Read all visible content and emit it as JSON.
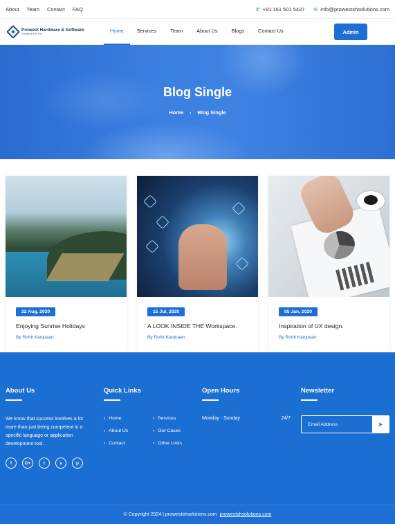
{
  "topbar": {
    "links": [
      "About",
      "Team",
      "Contact",
      "FAQ"
    ],
    "phone_icon": "phone-icon",
    "phone": "+91 161 501 5437",
    "email_icon": "mail-icon",
    "email": "info@prowestshsolutions.com"
  },
  "nav": {
    "logo_name": "Prowest Hardware & Software",
    "logo_sub": "Solutions Pvt. Ltd.",
    "items": [
      "Home",
      "Services",
      "Team",
      "About Us",
      "Blogs",
      "Contact Us"
    ],
    "active": "Home",
    "admin_label": "Admin",
    "accent": "#1d6fd6"
  },
  "hero": {
    "title": "Blog Single",
    "crumb_home": "Home",
    "crumb_sep": "›",
    "crumb_current": "Blog Single"
  },
  "posts": [
    {
      "date": "22 Aug, 2020",
      "title": "Enjoying Sunrise Holidays",
      "author": "By Rohit Kanjuaan"
    },
    {
      "date": "15 Jul, 2020",
      "title": "A LOOK INSIDE THE Workspace.",
      "author": "By Rohit Kanjuaan"
    },
    {
      "date": "05 Jan, 2020",
      "title": "Inspiration of UX design.",
      "author": "By Rohit Kanjuaan"
    }
  ],
  "footer": {
    "about_title": "About Us",
    "about_text": "We know that success involves a lot more than just being competent in a specific language or application development tool.",
    "socials": [
      "f",
      "G+",
      "t",
      "v",
      "p"
    ],
    "quick_title": "Quick Links",
    "quick_col1": [
      "Home",
      "About Us",
      "Contact"
    ],
    "quick_col2": [
      "Services",
      "Our Cases",
      "Other Links"
    ],
    "hours_title": "Open Hours",
    "hours_days": "Monday - Sunday",
    "hours_time": "24/7",
    "newsletter_title": "Newsletter",
    "newsletter_placeholder": "Email Address",
    "send_icon": "send-icon",
    "copyright": "© Copyright 2024 | prowestshsolutions.com",
    "copyright_link": "prowestshsolutions.com"
  }
}
